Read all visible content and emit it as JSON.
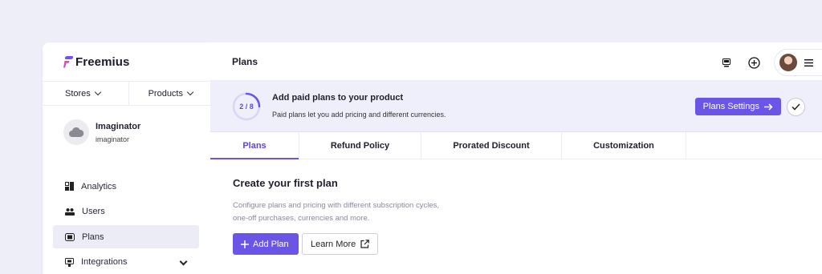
{
  "brand": {
    "name": "Freemius"
  },
  "selectors": {
    "stores": "Stores",
    "products": "Products"
  },
  "store": {
    "name": "Imaginator",
    "slug": "imaginator"
  },
  "nav": [
    {
      "label": "Analytics",
      "icon": "analytics-icon"
    },
    {
      "label": "Users",
      "icon": "users-icon"
    },
    {
      "label": "Plans",
      "icon": "plans-icon",
      "active": true
    },
    {
      "label": "Integrations",
      "icon": "integrations-icon"
    }
  ],
  "header": {
    "title": "Plans"
  },
  "banner": {
    "progress": "2 / 8",
    "progress_done": 2,
    "progress_total": 8,
    "title": "Add paid plans to your product",
    "subtitle": "Paid plans let you add pricing and different currencies.",
    "settings_button": "Plans Settings"
  },
  "tabs": [
    "Plans",
    "Refund Policy",
    "Prorated Discount",
    "Customization"
  ],
  "content": {
    "title": "Create your first plan",
    "desc_line1": "Configure plans and pricing with different subscription cycles,",
    "desc_line2": "one-off purchases, currencies and more.",
    "add_button": "Add Plan",
    "learn_button": "Learn More"
  },
  "colors": {
    "accent": "#6a55e6",
    "annotation": "#f03f70",
    "background": "#eeeef8"
  }
}
